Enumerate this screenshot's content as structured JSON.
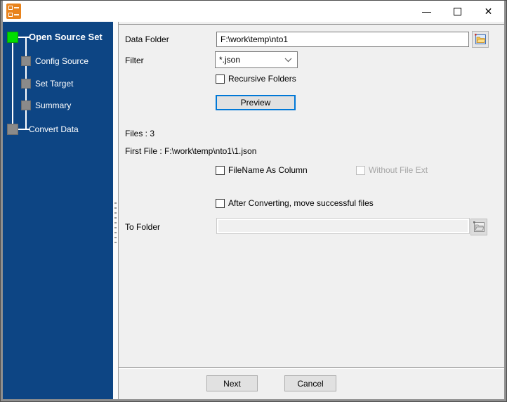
{
  "window": {
    "title": "",
    "controls": {
      "minimize": "—",
      "close": "✕"
    }
  },
  "colors": {
    "sidebar_background": "#0d4584",
    "active_step_marker": "#00dd00",
    "pending_step_marker": "#8a8a8a",
    "focus_accent": "#0078d7"
  },
  "sidebar": {
    "steps": [
      {
        "label": "Open Source Set",
        "state": "active"
      },
      {
        "label": "Config Source",
        "state": "pending"
      },
      {
        "label": "Set Target",
        "state": "pending"
      },
      {
        "label": "Summary",
        "state": "pending"
      },
      {
        "label": "Convert Data",
        "state": "pending"
      }
    ]
  },
  "form": {
    "data_folder": {
      "label": "Data Folder",
      "value": "F:\\work\\temp\\nto1"
    },
    "filter": {
      "label": "Filter",
      "value": "*.json"
    },
    "recursive": {
      "label": "Recursive Folders",
      "checked": false
    },
    "preview_button": "Preview",
    "files_count": "Files : 3",
    "first_file": "First File : F:\\work\\temp\\nto1\\1.json",
    "filename_as_column": {
      "label": "FileName As Column",
      "checked": false
    },
    "without_file_ext": {
      "label": "Without File Ext",
      "checked": false,
      "enabled": false
    },
    "move_files": {
      "label": "After Converting, move successful files",
      "checked": false
    },
    "to_folder": {
      "label": "To Folder",
      "value": "",
      "enabled": false
    }
  },
  "footer": {
    "next": "Next",
    "cancel": "Cancel"
  }
}
